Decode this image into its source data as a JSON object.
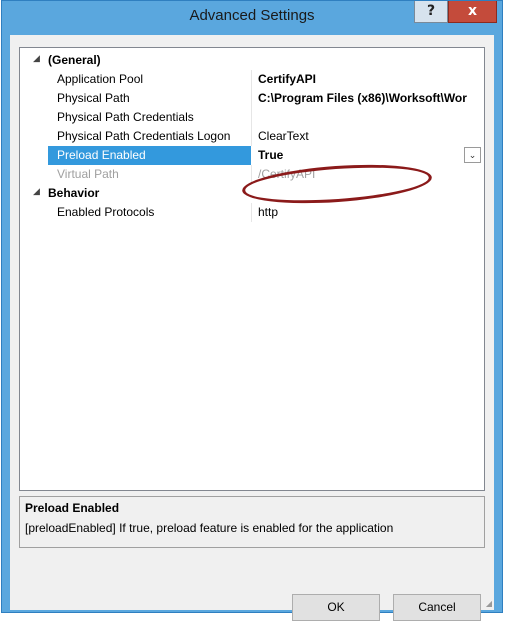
{
  "window": {
    "title": "Advanced Settings",
    "help_label": "?",
    "close_label": "x"
  },
  "grid": {
    "categories": [
      {
        "label": "(General)",
        "properties": [
          {
            "name": "Application Pool",
            "value": "CertifyAPI"
          },
          {
            "name": "Physical Path",
            "value": "C:\\Program Files (x86)\\Worksoft\\Wor"
          },
          {
            "name": "Physical Path Credentials",
            "value": ""
          },
          {
            "name": "Physical Path Credentials Logon",
            "value": "ClearText"
          },
          {
            "name": "Preload Enabled",
            "value": "True"
          },
          {
            "name": "Virtual Path",
            "value": "/CertifyAPI"
          }
        ]
      },
      {
        "label": "Behavior",
        "properties": [
          {
            "name": "Enabled Protocols",
            "value": "http"
          }
        ]
      }
    ],
    "expander_glyph": "◢",
    "dropdown_glyph": "⌄"
  },
  "description": {
    "title": "Preload Enabled",
    "text": "[preloadEnabled] If true, preload feature is enabled for the application"
  },
  "buttons": {
    "ok": "OK",
    "cancel": "Cancel"
  },
  "colors": {
    "titlebar": "#5aa7de",
    "selection": "#3399dd",
    "close": "#c44b3b",
    "annotation": "#8b1a1a"
  }
}
